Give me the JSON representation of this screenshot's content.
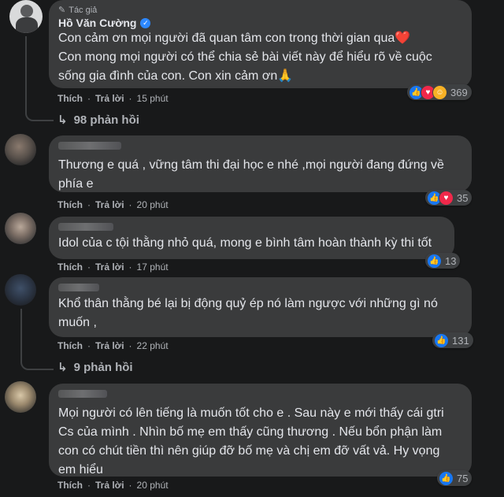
{
  "comments": [
    {
      "author_tag": "Tác giả",
      "author": "Hồ Văn Cường",
      "text": "Con cảm ơn mọi người đã quan tâm con trong thời gian qua❤️\nCon mong mọi người có thể chia sẻ bài viết này để hiểu rõ về cuộc\nsống gia đình của con. Con xin cảm ơn🙏",
      "like": "Thích",
      "reply": "Trả lời",
      "time": "15 phút",
      "reaction_count": "369",
      "replies": "98 phản hồi"
    },
    {
      "text": "Thương e quá , vững tâm thi đại học e nhé ,mọi người đang đứng về\nphía e",
      "like": "Thích",
      "reply": "Trả lời",
      "time": "20 phút",
      "reaction_count": "35"
    },
    {
      "text": "Idol của c tội thằng nhỏ quá, mong e bình tâm hoàn thành kỳ thi tốt",
      "like": "Thích",
      "reply": "Trả lời",
      "time": "17 phút",
      "reaction_count": "13"
    },
    {
      "text": "Khổ thân thằng bé lại bị động quỷ ép nó làm ngược với những gì nó\nmuốn ,",
      "like": "Thích",
      "reply": "Trả lời",
      "time": "22 phút",
      "reaction_count": "131",
      "replies": "9 phản hồi"
    },
    {
      "text": "Mọi người có lên tiếng là muốn tốt cho e . Sau này e mới thấy cái gtri\nCs của mình . Nhìn bố mẹ em thấy cũng thương . Nếu bổn phận làm\ncon có chút tiền thì nên giúp đỡ bố mẹ và chị em đỡ vất vả. Hy vọng\nem hiểu",
      "like": "Thích",
      "reply": "Trả lời",
      "time": "20 phút",
      "reaction_count": "75"
    }
  ],
  "colors": {
    "background": "#18191a",
    "bubble": "#3a3b3c",
    "text": "#e4e6eb",
    "secondary": "#b0b3b8",
    "like_blue": "#1877f2",
    "love_red": "#f0284a",
    "verified": "#2d88ff"
  },
  "icons": [
    "pencil-icon",
    "verified-badge-icon",
    "like-reaction-icon",
    "love-reaction-icon",
    "care-reaction-icon",
    "reply-arrow-icon"
  ]
}
